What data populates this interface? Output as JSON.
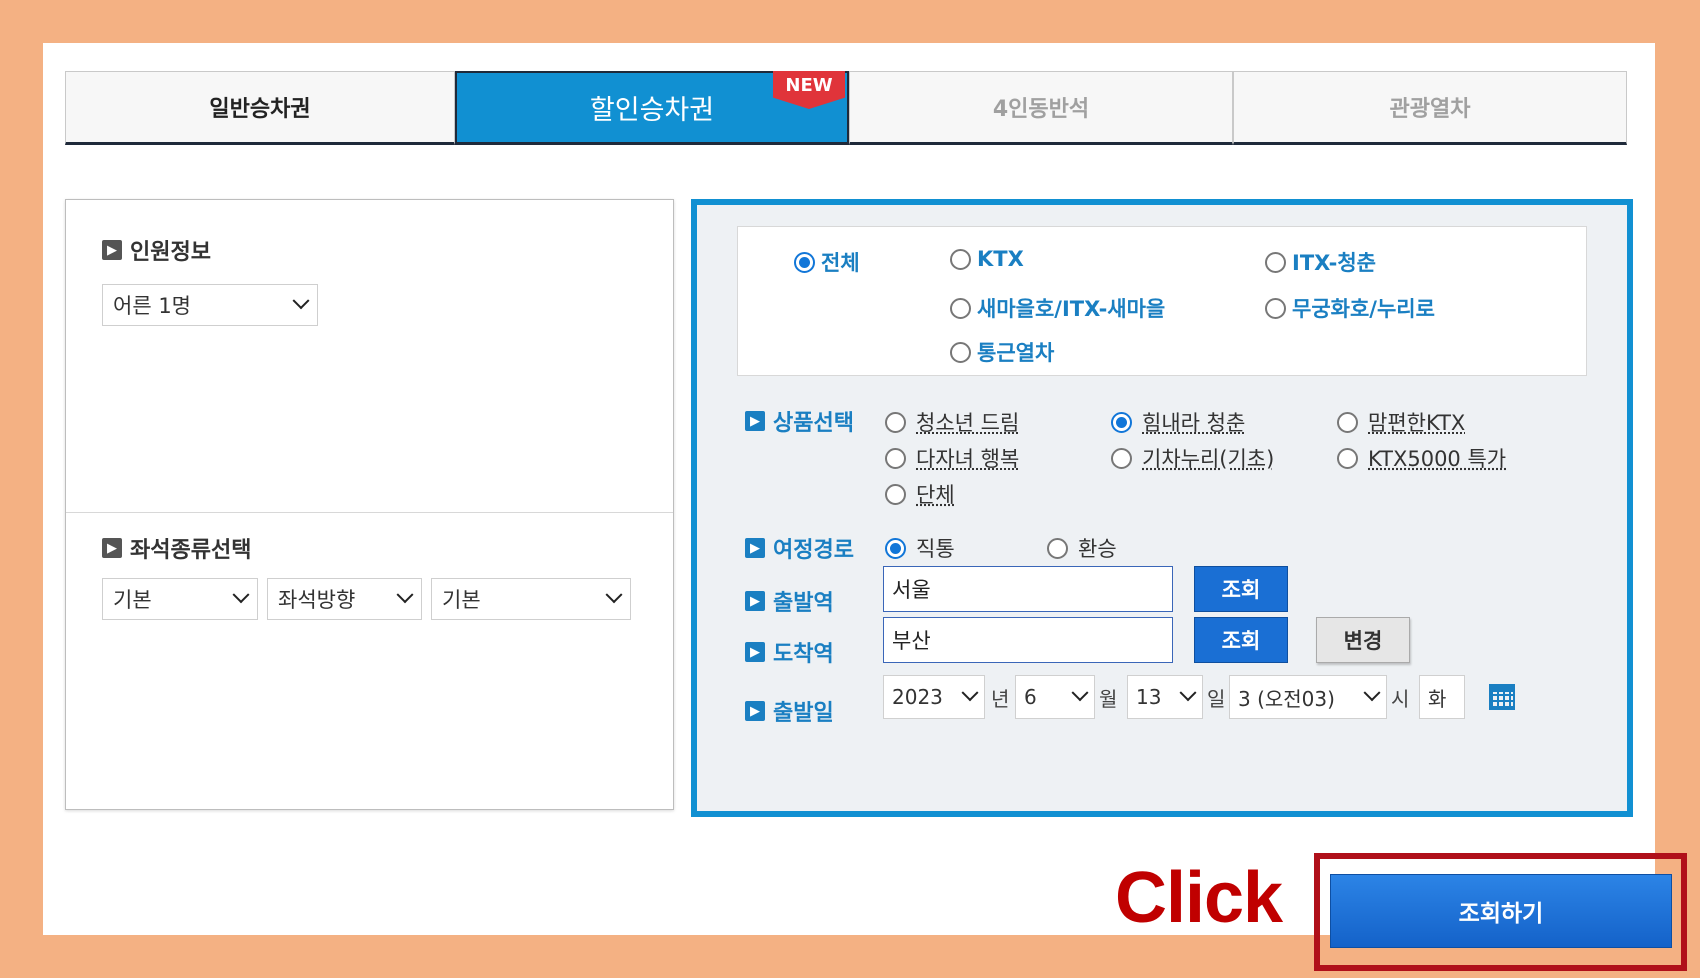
{
  "tabs": [
    {
      "label": "일반승차권"
    },
    {
      "label": "할인승차권"
    },
    {
      "label": "4인동반석"
    },
    {
      "label": "관광열차"
    }
  ],
  "new_badge": "NEW",
  "left": {
    "passenger_title": "인원정보",
    "passenger_select": "어른 1명",
    "seat_title": "좌석종류선택",
    "seat_selects": [
      "기본",
      "좌석방향",
      "기본"
    ]
  },
  "train_types": [
    "전체",
    "KTX",
    "ITX-청춘",
    "새마을호/ITX-새마을",
    "무궁화호/누리로",
    "통근열차"
  ],
  "product": {
    "label": "상품선택",
    "options": [
      "청소년 드림",
      "힘내라 청춘",
      "맘편한KTX",
      "다자녀 행복",
      "기차누리(기초)",
      "KTX5000 특가",
      "단체"
    ]
  },
  "route": {
    "label": "여정경로",
    "options": [
      "직통",
      "환승"
    ]
  },
  "departure": {
    "label": "출발역",
    "value": "서울",
    "button": "조회"
  },
  "arrival": {
    "label": "도착역",
    "value": "부산",
    "button": "조회",
    "change_button": "변경"
  },
  "date": {
    "label": "출발일",
    "year": "2023",
    "year_unit": "년",
    "month": "6",
    "month_unit": "월",
    "day": "13",
    "day_unit": "일",
    "hour": "3 (오전03)",
    "hour_unit": "시",
    "weekday": "화"
  },
  "annotation": "Click",
  "search_button": "조회하기",
  "colors": {
    "accent": "#1190d2",
    "highlight": "#b0101a",
    "frame": "#f4b183"
  }
}
